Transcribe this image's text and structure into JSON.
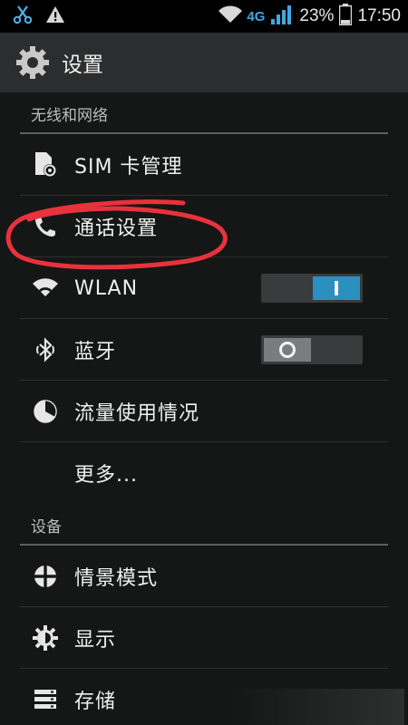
{
  "status_bar": {
    "network_type": "4G",
    "battery_percent": "23%",
    "time": "17:50",
    "icons": [
      "scissors-icon",
      "warning-icon",
      "wifi-icon",
      "signal-icon",
      "battery-icon"
    ]
  },
  "action_bar": {
    "title": "设置",
    "icon": "gear-icon"
  },
  "sections": [
    {
      "header": "无线和网络",
      "items": [
        {
          "label": "SIM 卡管理",
          "icon": "sim-card-icon"
        },
        {
          "label": "通话设置",
          "icon": "phone-icon",
          "highlight": "red-circle-annotation"
        },
        {
          "label": "WLAN",
          "icon": "wifi-icon",
          "toggle": "on"
        },
        {
          "label": "蓝牙",
          "icon": "bluetooth-icon",
          "toggle": "off"
        },
        {
          "label": "流量使用情况",
          "icon": "data-usage-icon"
        },
        {
          "label": "更多...",
          "icon": ""
        }
      ]
    },
    {
      "header": "设备",
      "items": [
        {
          "label": "情景模式",
          "icon": "audio-profile-icon"
        },
        {
          "label": "显示",
          "icon": "brightness-icon"
        },
        {
          "label": "存储",
          "icon": "storage-icon"
        }
      ]
    }
  ],
  "colors": {
    "background": "#151616",
    "action_bar": "#2c2d2e",
    "accent": "#2b8fbf",
    "annotation": "#e8323c"
  }
}
